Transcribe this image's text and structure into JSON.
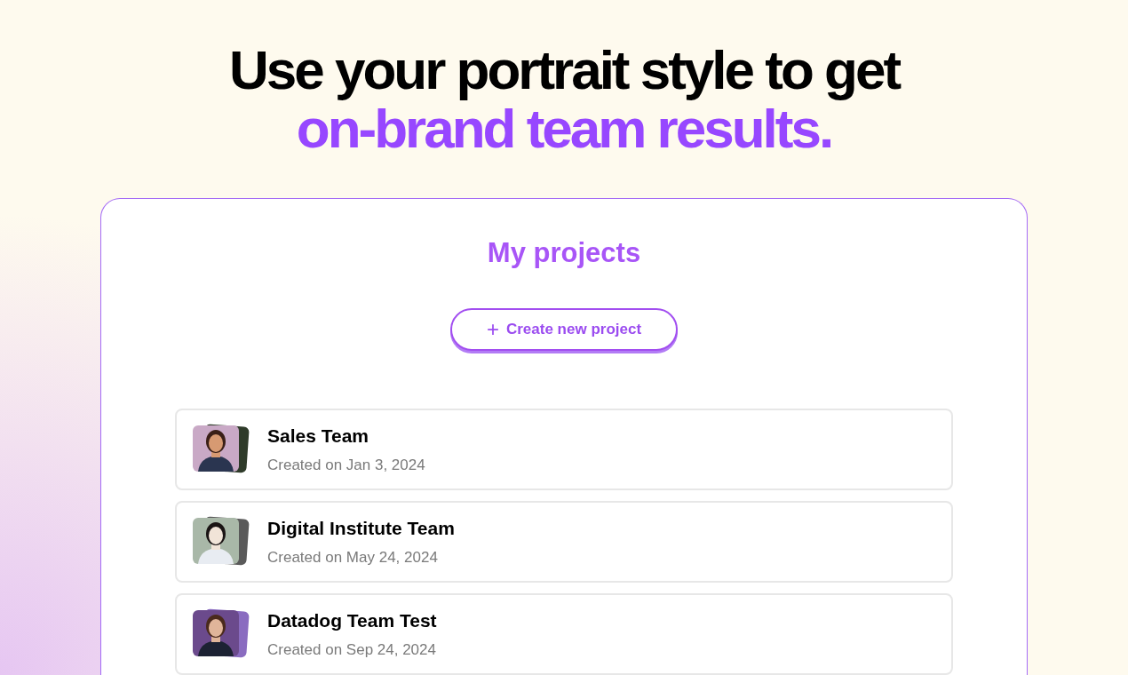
{
  "headline": {
    "line_1": "Use your portrait style to get",
    "line_2": "on-brand team results."
  },
  "panel": {
    "title": "My projects",
    "create_button": {
      "icon": "+",
      "label": "Create new project"
    }
  },
  "projects": [
    {
      "name": "Sales Team",
      "created": "Created on Jan 3, 2024"
    },
    {
      "name": "Digital Institute Team",
      "created": "Created on May 24, 2024"
    },
    {
      "name": "Datadog Team Test",
      "created": "Created on Sep 24, 2024"
    }
  ]
}
